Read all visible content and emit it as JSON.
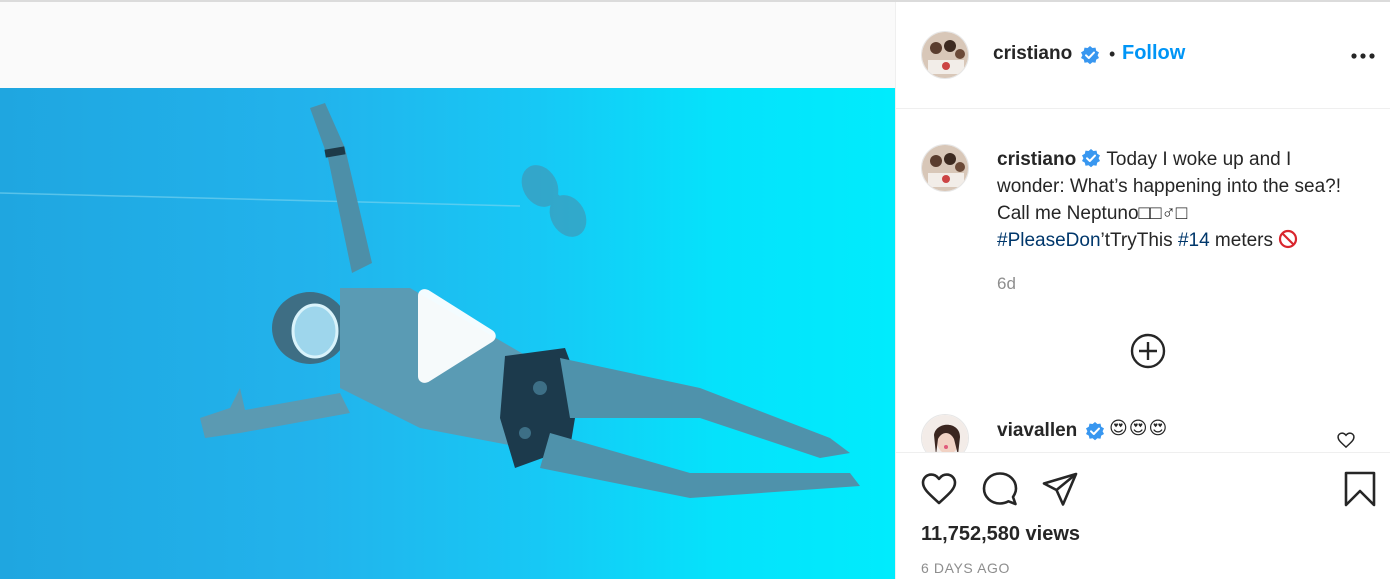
{
  "post": {
    "author": "cristiano",
    "follow_label": "Follow",
    "separator": "•",
    "caption_text": "Today I woke up and I wonder: What’s happening into the sea?! Call me Neptuno□□♂□",
    "hashtag_1": "#PleaseDon",
    "hashtag_1_rest": "’tTryThis",
    "hashtag_2": "#14",
    "caption_tail": "meters",
    "relative_time": "6d",
    "views": "11,752,580 views",
    "timestamp": "6 DAYS AGO"
  },
  "comment": {
    "author": "viavallen",
    "text": "😍😍😍"
  },
  "icons": {
    "play": "play-icon",
    "more": "more-options-icon",
    "verified": "verified-badge-icon",
    "load_more": "load-more-comments-icon",
    "like": "heart-icon",
    "comment": "comment-icon",
    "share": "share-icon",
    "save": "bookmark-icon",
    "no_entry": "no-entry-icon"
  },
  "colors": {
    "accent": "#0095f6",
    "hashtag": "#00376b",
    "verified": "#3897f0",
    "muted": "#8e8e8e",
    "water": "#17c8f5"
  }
}
